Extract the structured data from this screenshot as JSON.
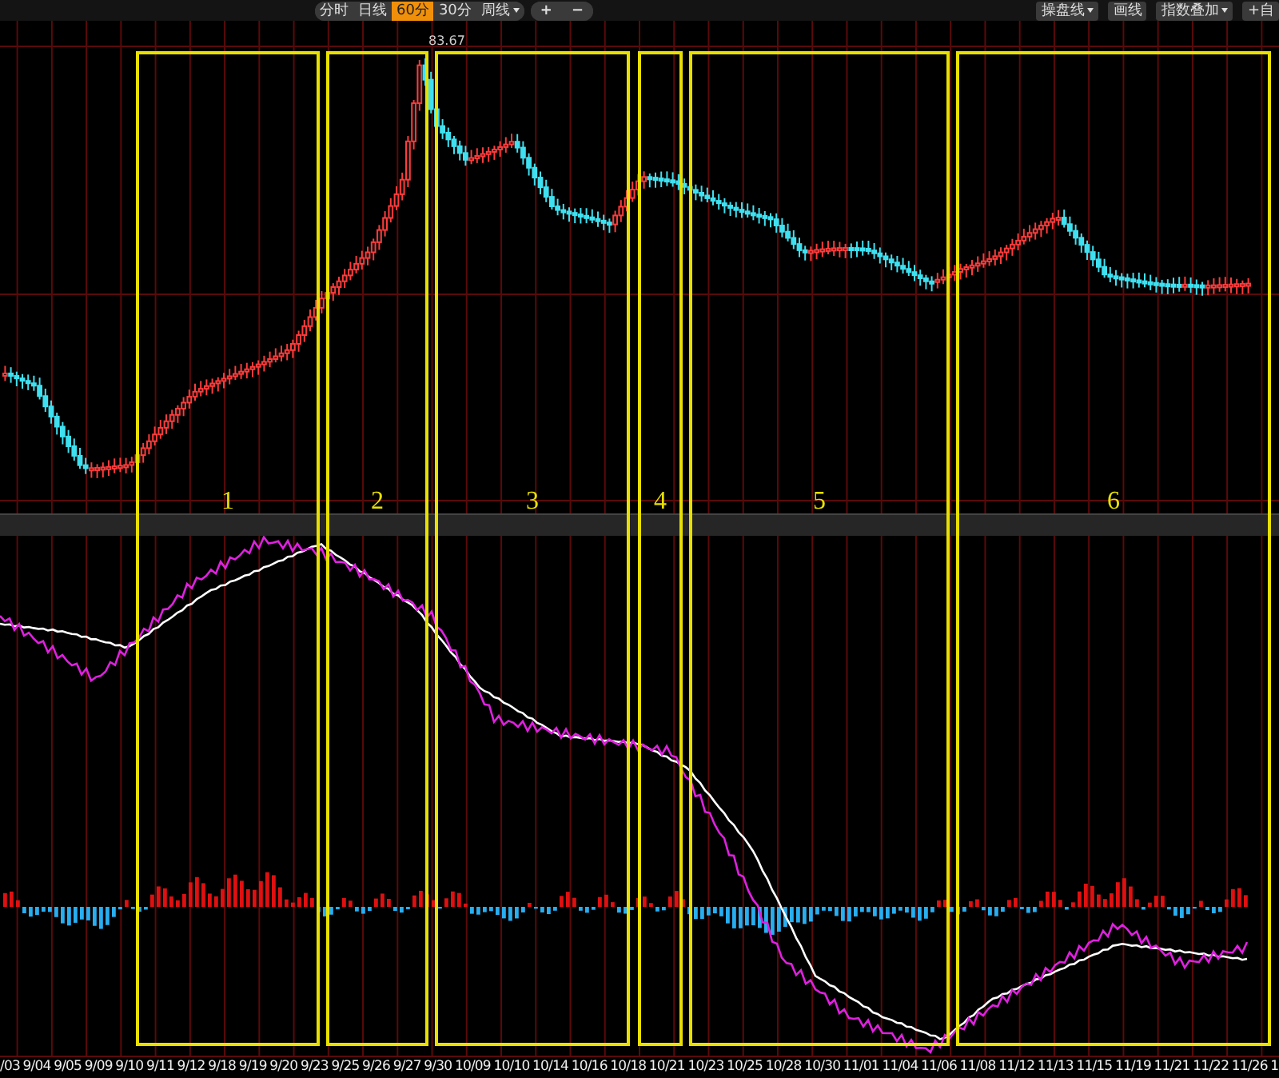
{
  "toolbar": {
    "period_buttons": [
      {
        "label": "分时",
        "selected": false,
        "dropdown": false
      },
      {
        "label": "日线",
        "selected": false,
        "dropdown": false
      },
      {
        "label": "60分",
        "selected": true,
        "dropdown": false
      },
      {
        "label": "30分",
        "selected": false,
        "dropdown": false
      },
      {
        "label": "周线",
        "selected": false,
        "dropdown": true
      }
    ],
    "zoom_buttons": [
      "+",
      "−"
    ],
    "right_buttons": [
      {
        "label": "操盘线",
        "dropdown": true
      },
      {
        "label": "画线",
        "dropdown": false
      },
      {
        "label": "指数叠加",
        "dropdown": true
      },
      {
        "label": "+自",
        "dropdown": false
      }
    ]
  },
  "price_chart": {
    "high_label": "83.67"
  },
  "zones": [
    {
      "label": "1"
    },
    {
      "label": "2"
    },
    {
      "label": "3"
    },
    {
      "label": "4"
    },
    {
      "label": "5"
    },
    {
      "label": "6"
    }
  ],
  "x_axis": [
    "/03",
    "9/04",
    "9/05",
    "9/09",
    "9/10",
    "9/11",
    "9/12",
    "9/18",
    "9/19",
    "9/20",
    "9/23",
    "9/25",
    "9/26",
    "9/27",
    "9/30",
    "10/09",
    "10/10",
    "10/14",
    "10/16",
    "10/18",
    "10/21",
    "10/23",
    "10/25",
    "10/28",
    "10/30",
    "11/01",
    "11/04",
    "11/06",
    "11/08",
    "11/12",
    "11/13",
    "11/15",
    "11/19",
    "11/21",
    "11/22",
    "11/26",
    "1"
  ]
}
